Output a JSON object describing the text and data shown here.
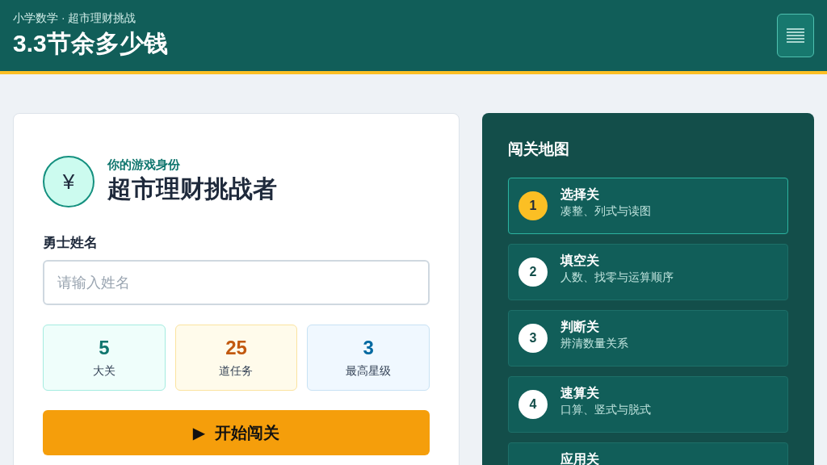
{
  "header": {
    "subtitle": "小学数学 · 超市理财挑战",
    "title": "3.3节余多少钱"
  },
  "identity": {
    "symbol": "¥",
    "caption": "你的游戏身份",
    "role": "超市理财挑战者"
  },
  "name_field": {
    "label": "勇士姓名",
    "placeholder": "请输入姓名"
  },
  "stats": [
    {
      "value": "5",
      "label": "大关",
      "color": "#0f766e"
    },
    {
      "value": "25",
      "label": "道任务",
      "color": "#c2590f"
    },
    {
      "value": "3",
      "label": "最高星级",
      "color": "#0369a1"
    }
  ],
  "start_button": {
    "icon": "▶",
    "label": "开始闯关"
  },
  "map": {
    "title": "闯关地图",
    "levels": [
      {
        "number": "1",
        "title": "选择关",
        "subtitle": "凑整、列式与读图",
        "selected": true
      },
      {
        "number": "2",
        "title": "填空关",
        "subtitle": "人数、找零与运算顺序",
        "selected": false
      },
      {
        "number": "3",
        "title": "判断关",
        "subtitle": "辨清数量关系",
        "selected": false
      },
      {
        "number": "4",
        "title": "速算关",
        "subtitle": "口算、竖式与脱式",
        "selected": false
      },
      {
        "title": "应用关",
        "selected": false
      }
    ]
  }
}
